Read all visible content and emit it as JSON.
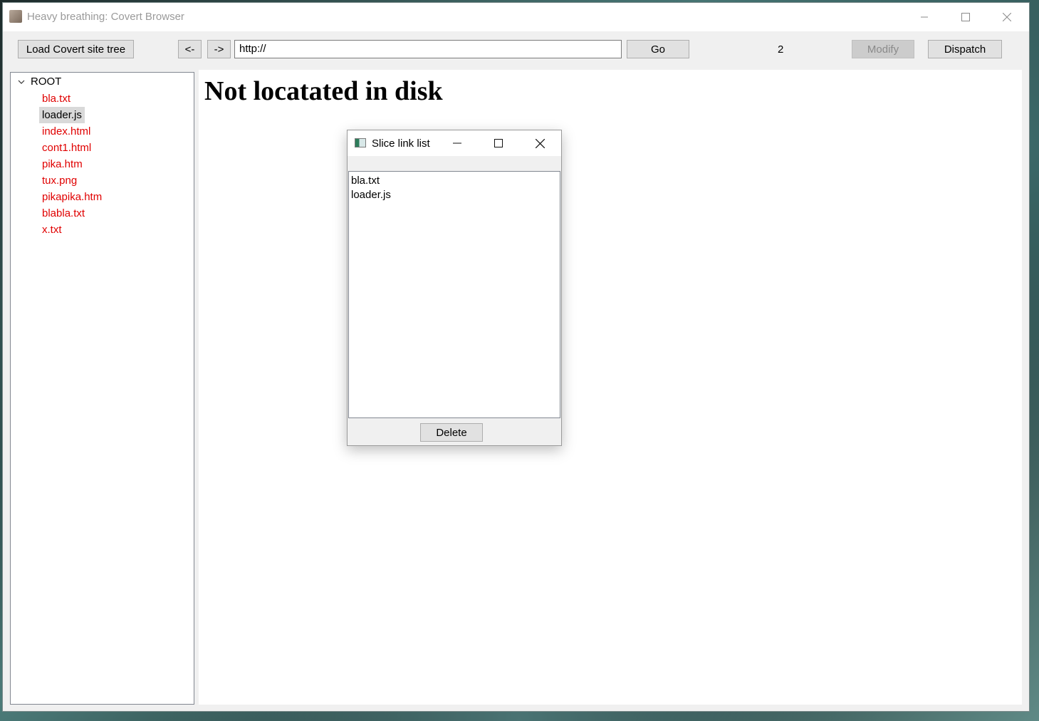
{
  "window": {
    "title": "Heavy breathing: Covert Browser"
  },
  "toolbar": {
    "load_label": "Load Covert site tree",
    "back_label": "<-",
    "forward_label": "->",
    "url_value": "http://",
    "go_label": "Go",
    "counter": "2",
    "modify_label": "Modify",
    "dispatch_label": "Dispatch"
  },
  "tree": {
    "root_label": "ROOT",
    "items": [
      {
        "label": "bla.txt",
        "selected": false
      },
      {
        "label": "loader.js",
        "selected": true
      },
      {
        "label": "index.html",
        "selected": false
      },
      {
        "label": "cont1.html",
        "selected": false
      },
      {
        "label": "pika.htm",
        "selected": false
      },
      {
        "label": "tux.png",
        "selected": false
      },
      {
        "label": "pikapika.htm",
        "selected": false
      },
      {
        "label": "blabla.txt",
        "selected": false
      },
      {
        "label": "x.txt",
        "selected": false
      }
    ]
  },
  "content": {
    "heading": "Not locatated in disk"
  },
  "dialog": {
    "title": "Slice link list",
    "list": [
      "bla.txt",
      "loader.js"
    ],
    "delete_label": "Delete"
  },
  "colors": {
    "tree_item": "#e00000",
    "selected_bg": "#d9d9d9"
  }
}
